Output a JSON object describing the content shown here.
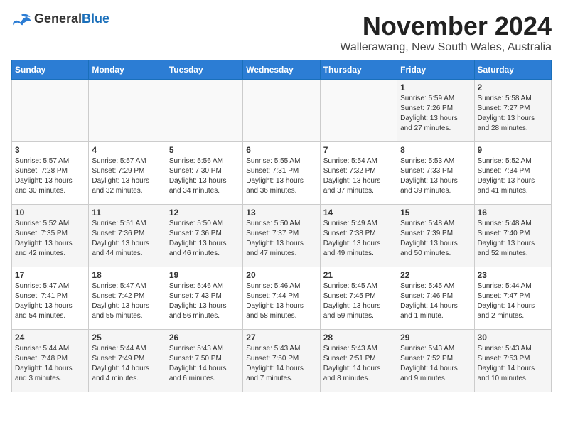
{
  "logo": {
    "general": "General",
    "blue": "Blue"
  },
  "title": "November 2024",
  "location": "Wallerawang, New South Wales, Australia",
  "days_of_week": [
    "Sunday",
    "Monday",
    "Tuesday",
    "Wednesday",
    "Thursday",
    "Friday",
    "Saturday"
  ],
  "weeks": [
    [
      {
        "day": "",
        "info": ""
      },
      {
        "day": "",
        "info": ""
      },
      {
        "day": "",
        "info": ""
      },
      {
        "day": "",
        "info": ""
      },
      {
        "day": "",
        "info": ""
      },
      {
        "day": "1",
        "info": "Sunrise: 5:59 AM\nSunset: 7:26 PM\nDaylight: 13 hours\nand 27 minutes."
      },
      {
        "day": "2",
        "info": "Sunrise: 5:58 AM\nSunset: 7:27 PM\nDaylight: 13 hours\nand 28 minutes."
      }
    ],
    [
      {
        "day": "3",
        "info": "Sunrise: 5:57 AM\nSunset: 7:28 PM\nDaylight: 13 hours\nand 30 minutes."
      },
      {
        "day": "4",
        "info": "Sunrise: 5:57 AM\nSunset: 7:29 PM\nDaylight: 13 hours\nand 32 minutes."
      },
      {
        "day": "5",
        "info": "Sunrise: 5:56 AM\nSunset: 7:30 PM\nDaylight: 13 hours\nand 34 minutes."
      },
      {
        "day": "6",
        "info": "Sunrise: 5:55 AM\nSunset: 7:31 PM\nDaylight: 13 hours\nand 36 minutes."
      },
      {
        "day": "7",
        "info": "Sunrise: 5:54 AM\nSunset: 7:32 PM\nDaylight: 13 hours\nand 37 minutes."
      },
      {
        "day": "8",
        "info": "Sunrise: 5:53 AM\nSunset: 7:33 PM\nDaylight: 13 hours\nand 39 minutes."
      },
      {
        "day": "9",
        "info": "Sunrise: 5:52 AM\nSunset: 7:34 PM\nDaylight: 13 hours\nand 41 minutes."
      }
    ],
    [
      {
        "day": "10",
        "info": "Sunrise: 5:52 AM\nSunset: 7:35 PM\nDaylight: 13 hours\nand 42 minutes."
      },
      {
        "day": "11",
        "info": "Sunrise: 5:51 AM\nSunset: 7:36 PM\nDaylight: 13 hours\nand 44 minutes."
      },
      {
        "day": "12",
        "info": "Sunrise: 5:50 AM\nSunset: 7:36 PM\nDaylight: 13 hours\nand 46 minutes."
      },
      {
        "day": "13",
        "info": "Sunrise: 5:50 AM\nSunset: 7:37 PM\nDaylight: 13 hours\nand 47 minutes."
      },
      {
        "day": "14",
        "info": "Sunrise: 5:49 AM\nSunset: 7:38 PM\nDaylight: 13 hours\nand 49 minutes."
      },
      {
        "day": "15",
        "info": "Sunrise: 5:48 AM\nSunset: 7:39 PM\nDaylight: 13 hours\nand 50 minutes."
      },
      {
        "day": "16",
        "info": "Sunrise: 5:48 AM\nSunset: 7:40 PM\nDaylight: 13 hours\nand 52 minutes."
      }
    ],
    [
      {
        "day": "17",
        "info": "Sunrise: 5:47 AM\nSunset: 7:41 PM\nDaylight: 13 hours\nand 54 minutes."
      },
      {
        "day": "18",
        "info": "Sunrise: 5:47 AM\nSunset: 7:42 PM\nDaylight: 13 hours\nand 55 minutes."
      },
      {
        "day": "19",
        "info": "Sunrise: 5:46 AM\nSunset: 7:43 PM\nDaylight: 13 hours\nand 56 minutes."
      },
      {
        "day": "20",
        "info": "Sunrise: 5:46 AM\nSunset: 7:44 PM\nDaylight: 13 hours\nand 58 minutes."
      },
      {
        "day": "21",
        "info": "Sunrise: 5:45 AM\nSunset: 7:45 PM\nDaylight: 13 hours\nand 59 minutes."
      },
      {
        "day": "22",
        "info": "Sunrise: 5:45 AM\nSunset: 7:46 PM\nDaylight: 14 hours\nand 1 minute."
      },
      {
        "day": "23",
        "info": "Sunrise: 5:44 AM\nSunset: 7:47 PM\nDaylight: 14 hours\nand 2 minutes."
      }
    ],
    [
      {
        "day": "24",
        "info": "Sunrise: 5:44 AM\nSunset: 7:48 PM\nDaylight: 14 hours\nand 3 minutes."
      },
      {
        "day": "25",
        "info": "Sunrise: 5:44 AM\nSunset: 7:49 PM\nDaylight: 14 hours\nand 4 minutes."
      },
      {
        "day": "26",
        "info": "Sunrise: 5:43 AM\nSunset: 7:50 PM\nDaylight: 14 hours\nand 6 minutes."
      },
      {
        "day": "27",
        "info": "Sunrise: 5:43 AM\nSunset: 7:50 PM\nDaylight: 14 hours\nand 7 minutes."
      },
      {
        "day": "28",
        "info": "Sunrise: 5:43 AM\nSunset: 7:51 PM\nDaylight: 14 hours\nand 8 minutes."
      },
      {
        "day": "29",
        "info": "Sunrise: 5:43 AM\nSunset: 7:52 PM\nDaylight: 14 hours\nand 9 minutes."
      },
      {
        "day": "30",
        "info": "Sunrise: 5:43 AM\nSunset: 7:53 PM\nDaylight: 14 hours\nand 10 minutes."
      }
    ]
  ]
}
